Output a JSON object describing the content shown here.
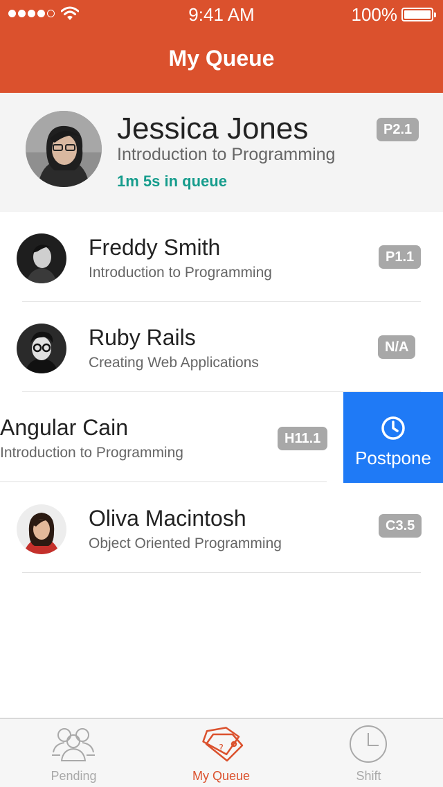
{
  "status_bar": {
    "time": "9:41 AM",
    "battery": "100%"
  },
  "nav": {
    "title": "My Queue"
  },
  "current": {
    "name": "Jessica Jones",
    "course": "Introduction to Programming",
    "wait": "1m 5s in queue",
    "badge": "P2.1"
  },
  "queue": [
    {
      "name": "Freddy Smith",
      "course": "Introduction to Programming",
      "badge": "P1.1"
    },
    {
      "name": "Ruby Rails",
      "course": "Creating Web Applications",
      "badge": "N/A"
    },
    {
      "name": "Angular Cain",
      "course": "Introduction to Programming",
      "badge": "H11.1"
    },
    {
      "name": "Oliva Macintosh",
      "course": "Object Oriented Programming",
      "badge": "C3.5"
    }
  ],
  "swipe_action": {
    "label": "Postpone",
    "icon": "clock-icon",
    "color": "#1F7AF6"
  },
  "tabs": [
    {
      "label": "Pending",
      "icon": "people-group-icon"
    },
    {
      "label": "My Queue",
      "icon": "tags-icon"
    },
    {
      "label": "Shift",
      "icon": "clock-icon"
    }
  ],
  "colors": {
    "brand": "#DB512D",
    "accent_green": "#159C8C",
    "badge": "#A8A8A8"
  }
}
